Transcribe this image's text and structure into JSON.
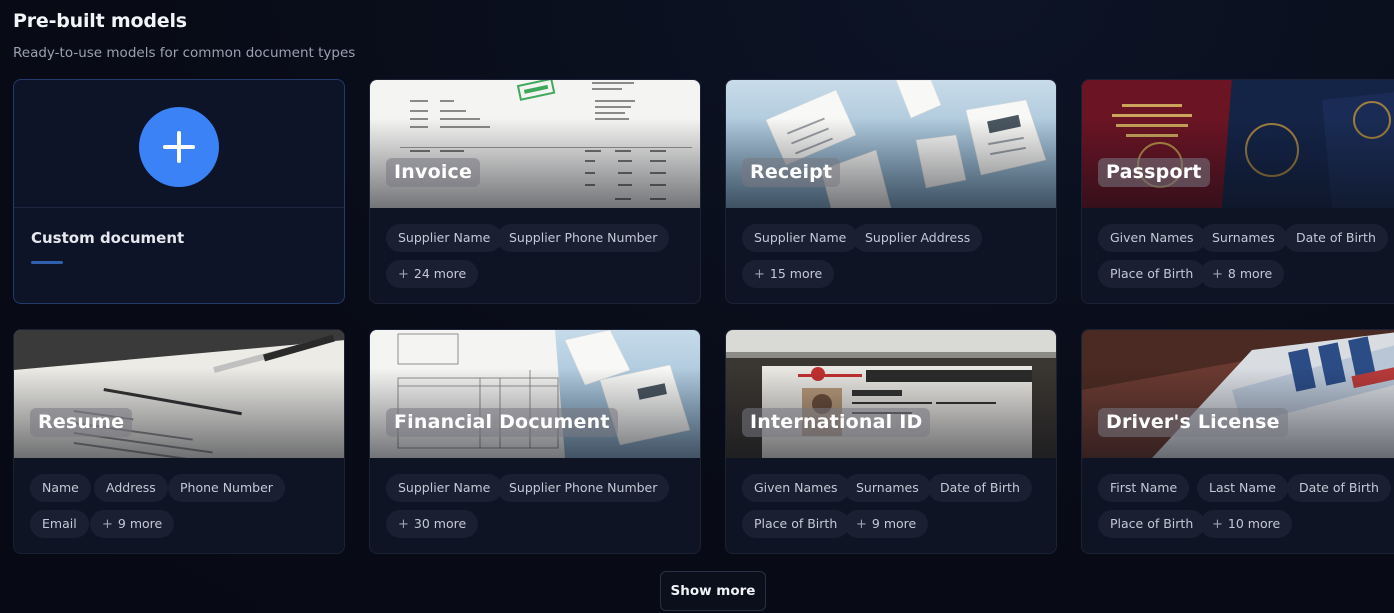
{
  "header": {
    "title": "Pre-built models",
    "subtitle": "Ready-to-use models for common document types"
  },
  "custom_card": {
    "label": "Custom document",
    "icon": "plus-icon"
  },
  "models": [
    {
      "name": "Invoice",
      "tags": [
        "Supplier Name",
        "Supplier Phone Number"
      ],
      "more": "24 more"
    },
    {
      "name": "Receipt",
      "tags": [
        "Supplier Name",
        "Supplier Address"
      ],
      "more": "15 more"
    },
    {
      "name": "Passport",
      "tags": [
        "Given Names",
        "Surnames",
        "Date of Birth",
        "Place of Birth"
      ],
      "more": "8 more"
    },
    {
      "name": "Resume",
      "tags": [
        "Name",
        "Address",
        "Phone Number",
        "Email"
      ],
      "more": "9 more"
    },
    {
      "name": "Financial Document",
      "tags": [
        "Supplier Name",
        "Supplier Phone Number"
      ],
      "more": "30 more"
    },
    {
      "name": "International ID",
      "tags": [
        "Given Names",
        "Surnames",
        "Date of Birth",
        "Place of Birth"
      ],
      "more": "9 more"
    },
    {
      "name": "Driver's License",
      "tags": [
        "First Name",
        "Last Name",
        "Date of Birth",
        "Place of Birth"
      ],
      "more": "10 more"
    }
  ],
  "show_more_label": "Show more",
  "colors": {
    "accent": "#3b82f6",
    "background": "#080b16",
    "card": "#0f1424"
  }
}
